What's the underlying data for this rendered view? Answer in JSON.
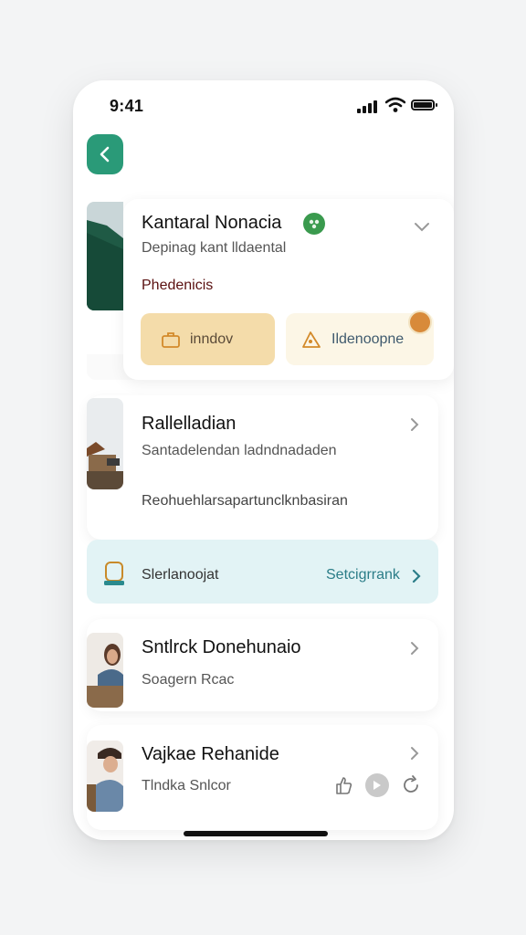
{
  "status_bar": {
    "time": "9:41"
  },
  "featured": {
    "title": "Kantaral Nonacia",
    "subtitle": "Depinag kant lldaental",
    "tag": "Phedenicis",
    "buttons": [
      {
        "label": "inndov",
        "icon": "briefcase-icon"
      },
      {
        "label": "Ildenoopne",
        "icon": "tag-icon"
      }
    ]
  },
  "second": {
    "title": "Rallelladian",
    "subtitle": "Santadelendan ladndnadaden",
    "detail": "Reohuehlarsapartunclknbasiran"
  },
  "banner": {
    "label": "Slerlanoojat",
    "action": "Setcigrrank",
    "icon": "chair-icon"
  },
  "people": [
    {
      "name": "Sntlrck Donehunaio",
      "meta": "Soagern Rcac"
    },
    {
      "name": "Vajkae Rehanide",
      "meta": "Tlndka Snlcor"
    }
  ],
  "colors": {
    "accent": "#2a9a78",
    "verified": "#3a9a4e",
    "primary_pill": "#f4dcaa",
    "secondary_pill": "#fcf6e6",
    "banner_bg": "#e2f3f5",
    "banner_action": "#2b7d88"
  }
}
